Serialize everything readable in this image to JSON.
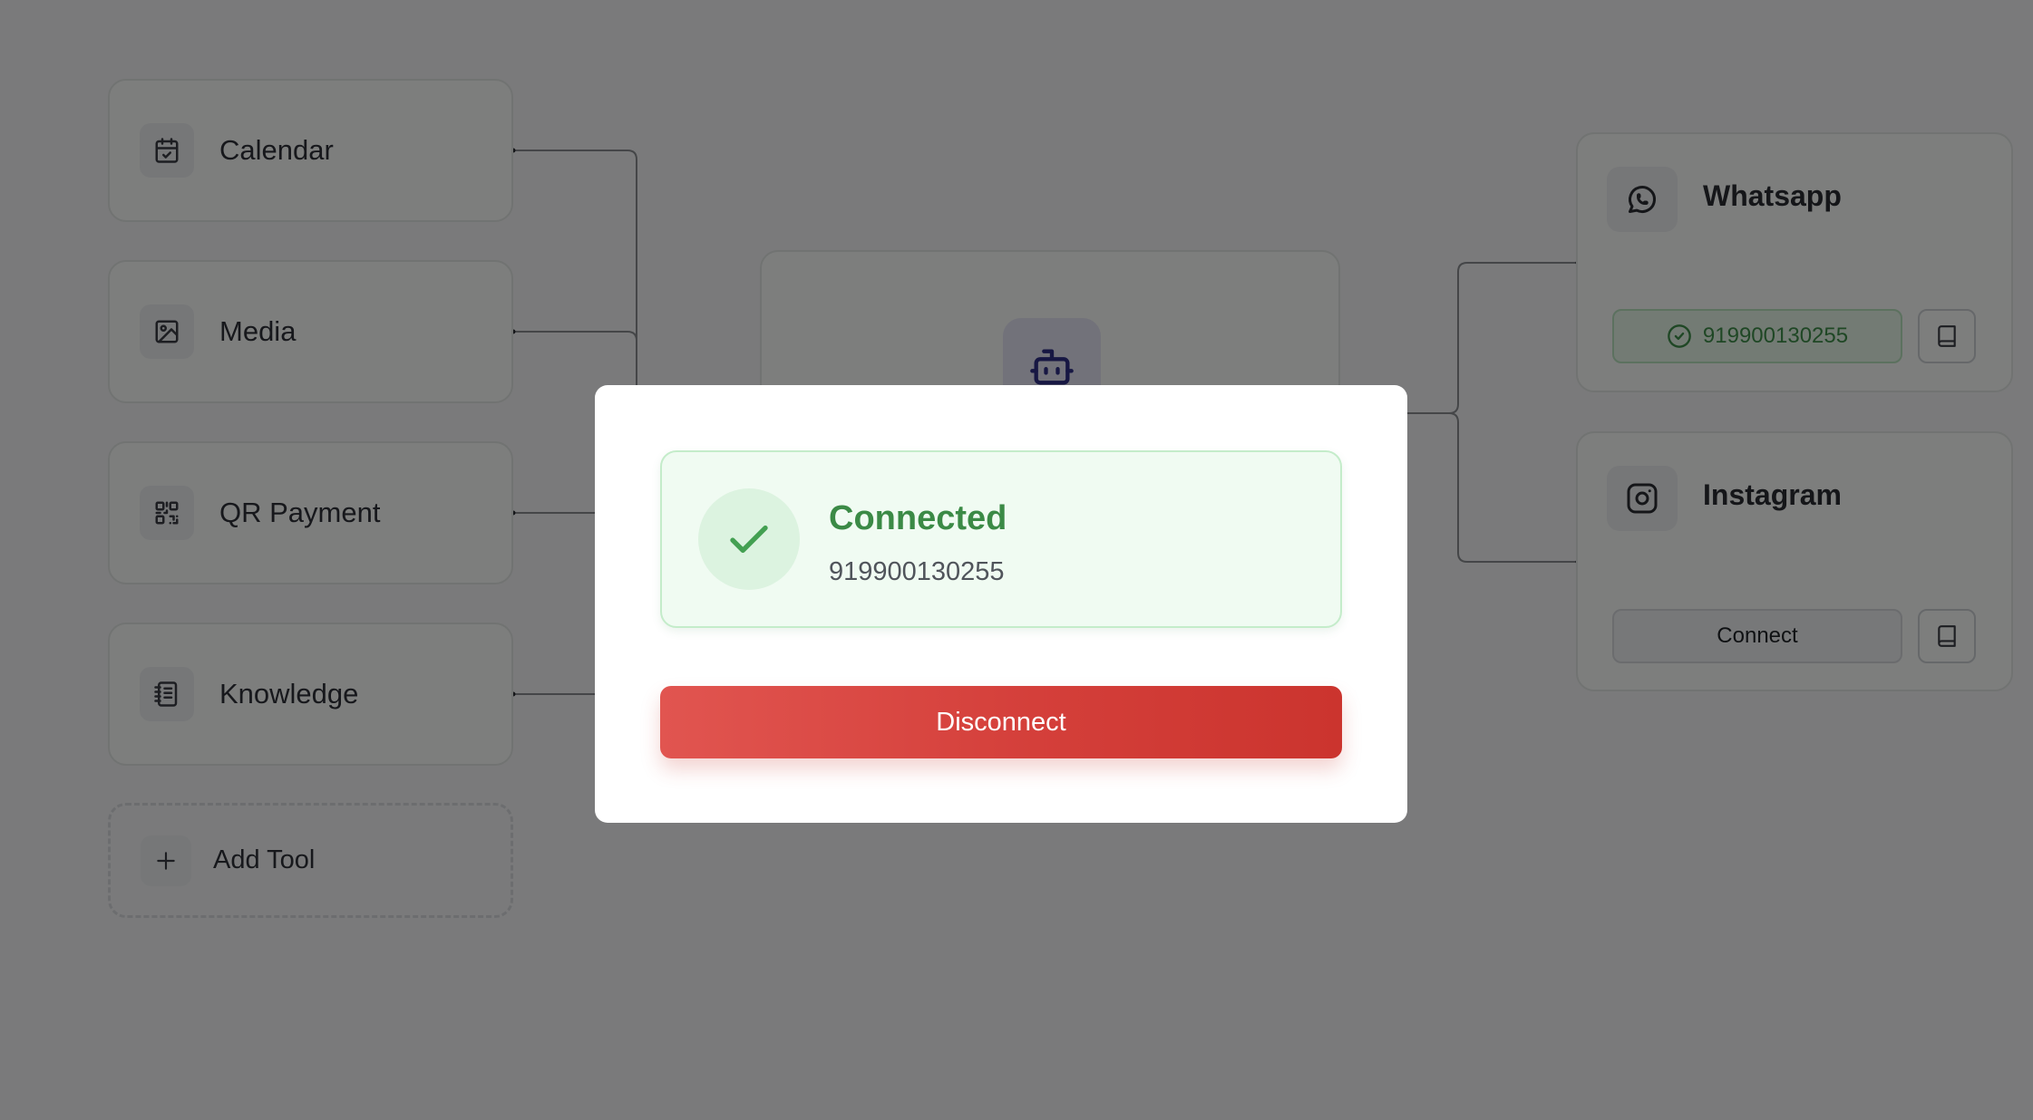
{
  "tools": [
    {
      "label": "Calendar",
      "icon": "calendar-check-icon"
    },
    {
      "label": "Media",
      "icon": "image-icon"
    },
    {
      "label": "QR Payment",
      "icon": "qr-code-icon"
    },
    {
      "label": "Knowledge",
      "icon": "notebook-icon"
    }
  ],
  "add_tool": {
    "label": "Add Tool",
    "icon": "plus-icon"
  },
  "agent": {
    "icon": "bot-icon"
  },
  "channels": [
    {
      "name": "Whatsapp",
      "icon": "whatsapp-icon",
      "status_label": "919900130255",
      "status": "connected",
      "doc_icon": "book-icon"
    },
    {
      "name": "Instagram",
      "icon": "instagram-icon",
      "status_label": "Connect",
      "status": "disconnected",
      "doc_icon": "book-icon"
    }
  ],
  "modal": {
    "status_title": "Connected",
    "phone_number": "919900130255",
    "disconnect_label": "Disconnect",
    "icon": "checkmark-icon"
  },
  "colors": {
    "success": "#3b8a46",
    "danger": "#d43f3a",
    "agent_accent": "#2e2f86",
    "overlay": "rgba(0,0,0,0.5)"
  }
}
